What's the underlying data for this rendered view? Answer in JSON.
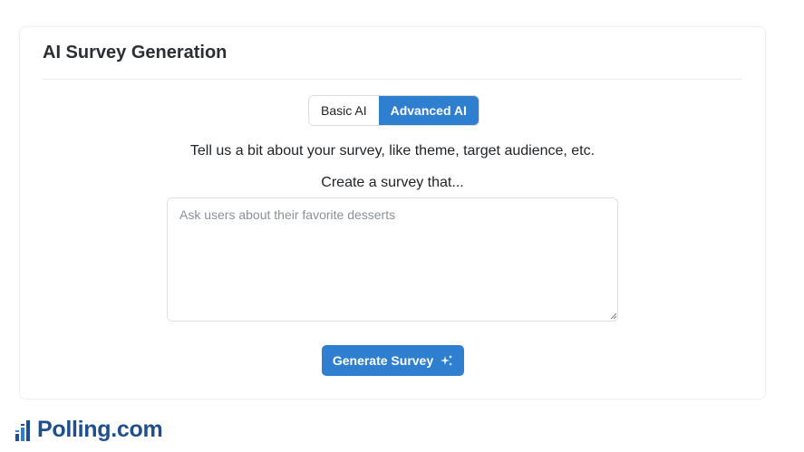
{
  "card": {
    "title": "AI Survey Generation"
  },
  "mode_toggle": {
    "options": [
      "Basic AI",
      "Advanced AI"
    ],
    "selected": "Advanced AI"
  },
  "instructions": {
    "lead": "Tell us a bit about your survey, like theme, target audience, etc.",
    "sub": "Create a survey that..."
  },
  "prompt": {
    "value": "",
    "placeholder": "Ask users about their favorite desserts"
  },
  "generate": {
    "label": "Generate Survey",
    "icon": "sparkle-icon"
  },
  "brand": {
    "name": "Polling.com",
    "icon": "bar-chart-logo-icon"
  },
  "colors": {
    "accent": "#2f7fd1",
    "brand": "#1d4f91"
  }
}
